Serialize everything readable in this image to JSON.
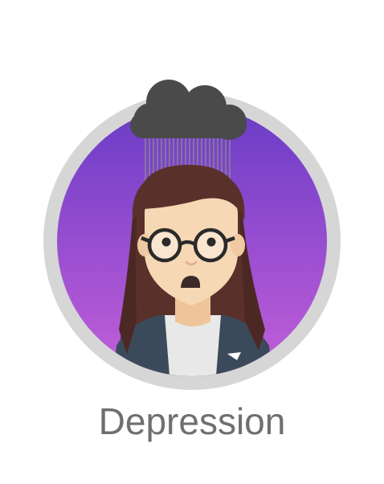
{
  "caption": "Depression",
  "icons": {
    "cloud": "rain-cloud-icon",
    "person": "sad-woman-with-glasses"
  },
  "colors": {
    "ring": "#d6d6d6",
    "gradient_top": "#6a3cc6",
    "gradient_bottom": "#c35fd9",
    "cloud": "#4a4a4a",
    "rain": "#8a8a8a",
    "hair": "#5a302b",
    "skin": "#f7d8b5",
    "jacket": "#3a4a5a",
    "shirt": "#e8e8e8",
    "caption": "#6f6f6f"
  }
}
